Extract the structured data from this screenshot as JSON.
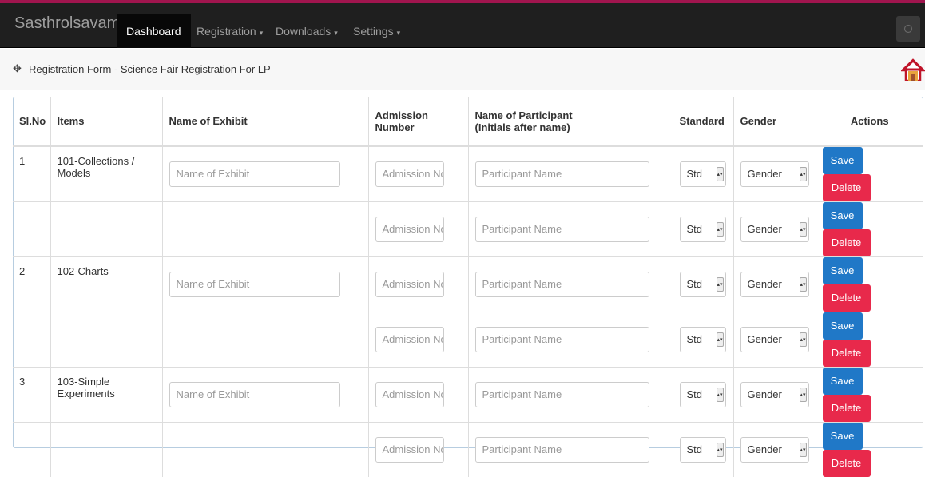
{
  "navbar": {
    "brand": "Sasthrolsavam",
    "items": [
      {
        "label": "Dashboard",
        "caret": ""
      },
      {
        "label": "Registration",
        "caret": "▾"
      },
      {
        "label": "Downloads",
        "caret": "▾"
      },
      {
        "label": "Settings",
        "caret": "▾"
      }
    ]
  },
  "breadcrumb": {
    "icon": "✥",
    "text": "Registration Form - Science Fair Registration For LP"
  },
  "table": {
    "headers": {
      "slno": "Sl.No",
      "items": "Items",
      "exhibit": "Name of Exhibit",
      "admission_1": "Admission",
      "admission_2": "Number",
      "participant_1": "Name of Participant",
      "participant_2": "(Initials after name)",
      "standard": "Standard",
      "gender": "Gender",
      "actions": "Actions"
    },
    "placeholders": {
      "exhibit": "Name of Exhibit",
      "admission": "Admission No",
      "participant": "Participant Name",
      "std": "Std",
      "gender": "Gender"
    },
    "buttons": {
      "save": "Save",
      "delete": "Delete"
    },
    "rows": [
      {
        "slno": "1",
        "item_1": "101-Collections /",
        "item_2": "Models",
        "has_exhibit": true
      },
      {
        "slno": "",
        "item_1": "",
        "item_2": "",
        "has_exhibit": false
      },
      {
        "slno": "2",
        "item_1": "102-Charts",
        "item_2": "",
        "has_exhibit": true
      },
      {
        "slno": "",
        "item_1": "",
        "item_2": "",
        "has_exhibit": false
      },
      {
        "slno": "3",
        "item_1": "103-Simple",
        "item_2": "Experiments",
        "has_exhibit": true
      },
      {
        "slno": "",
        "item_1": "",
        "item_2": "",
        "has_exhibit": false
      }
    ]
  },
  "colors": {
    "navbar": "#1f1f1f",
    "topline": "#a0154e",
    "save": "#2078c7",
    "delete": "#e8294b"
  }
}
